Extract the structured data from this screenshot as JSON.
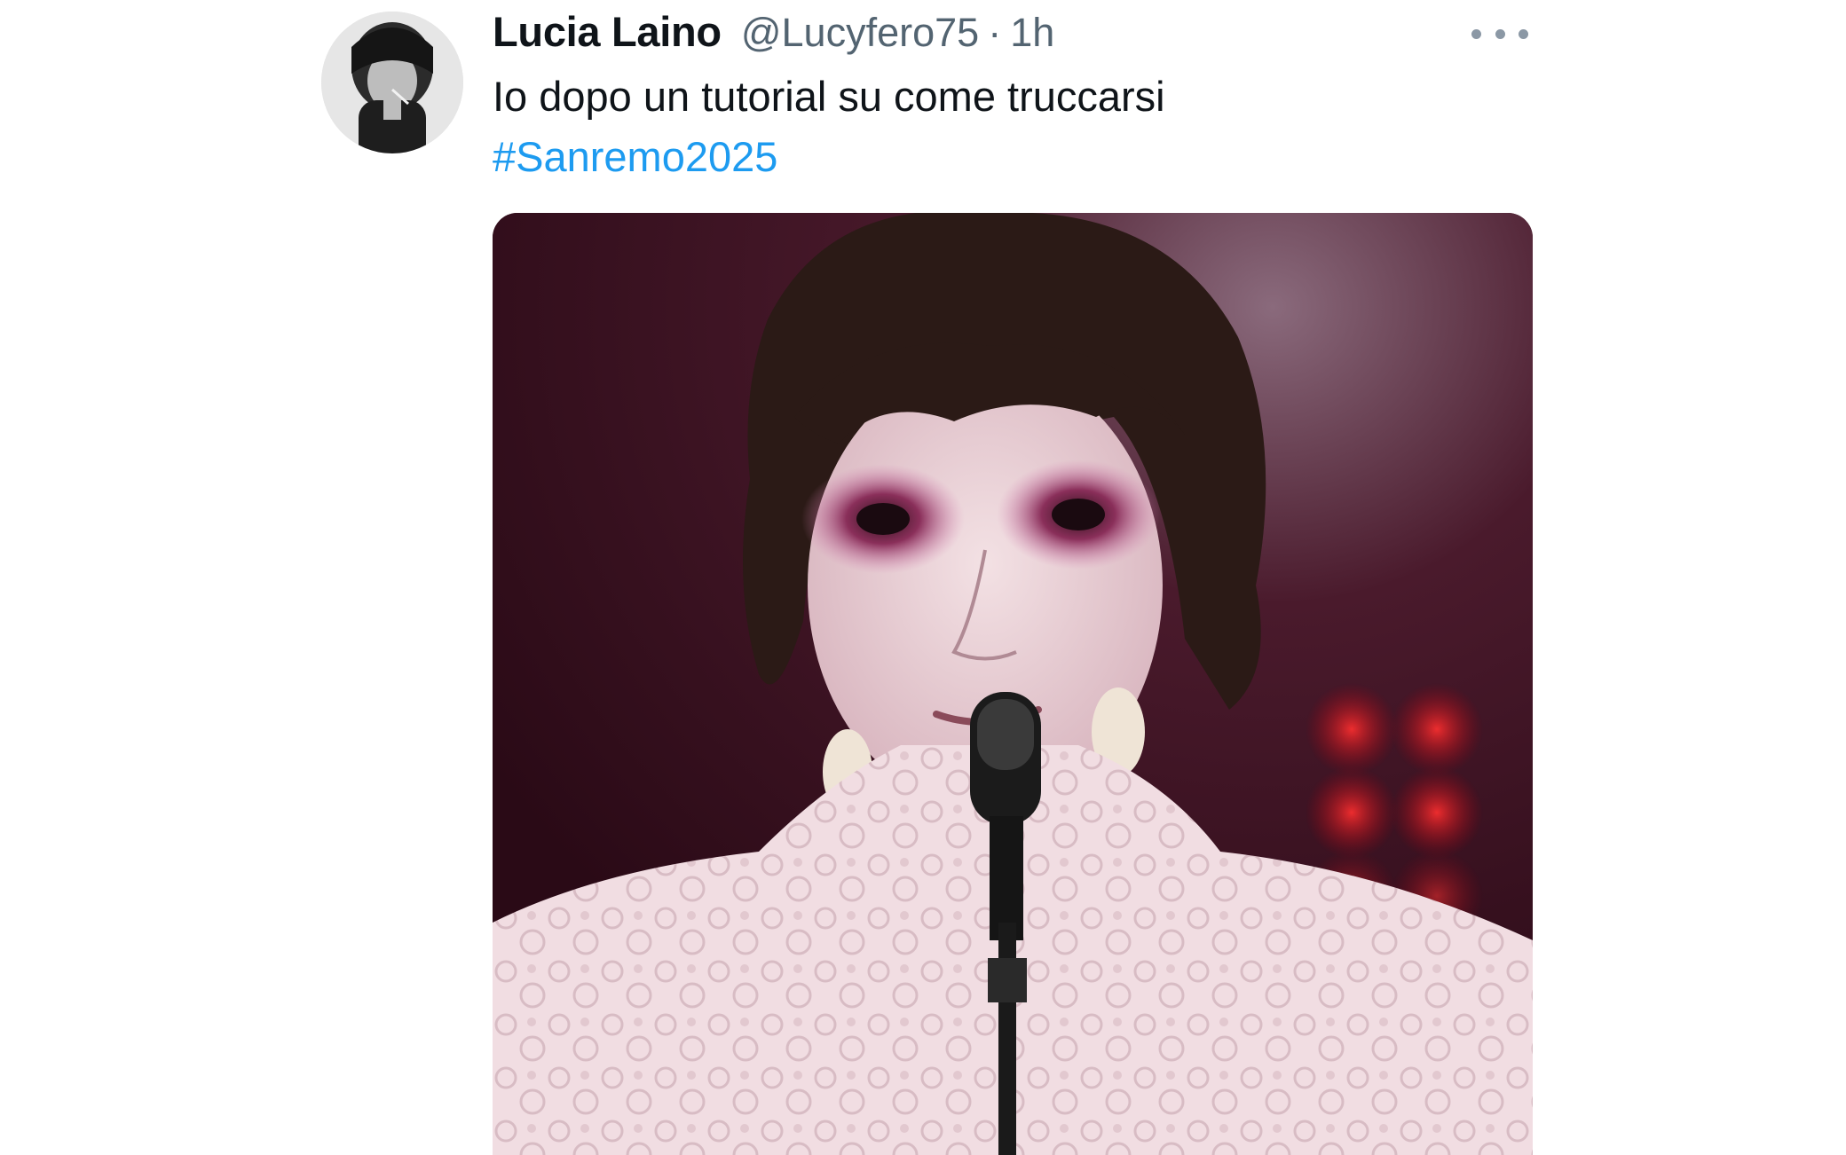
{
  "tweet": {
    "display_name": "Lucia Laino",
    "handle": "@Lucyfero75",
    "separator": "·",
    "time": "1h",
    "text": "Io dopo un tutorial su come truccarsi",
    "hashtag": "#Sanremo2025"
  },
  "icons": {
    "more": "more-horizontal-icon"
  },
  "colors": {
    "name": "#0f1419",
    "meta": "#536471",
    "hashtag": "#1d9bf0",
    "stage_background": "#3a0f1f",
    "stage_light": "#ff2a2a"
  }
}
